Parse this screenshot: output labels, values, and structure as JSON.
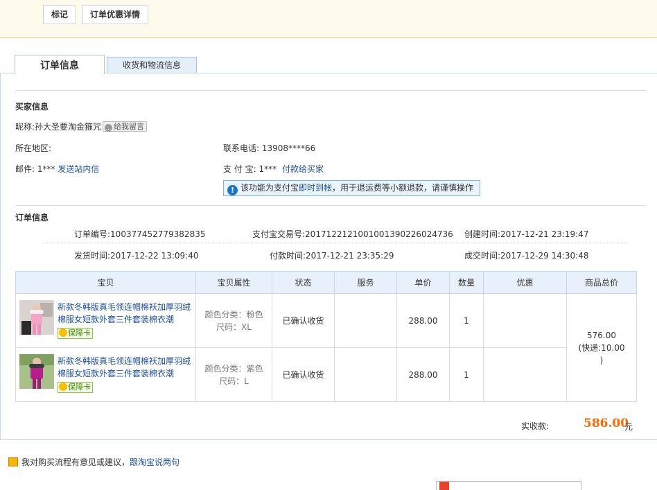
{
  "toolbar": {
    "mark_label": "标记",
    "discount_label": "订单优惠详情"
  },
  "tabs": [
    {
      "label": "订单信息"
    },
    {
      "label": "收货和物流信息"
    }
  ],
  "buyer": {
    "heading": "买家信息",
    "nickname_label": "昵称:",
    "nickname": "孙大圣要淘金箍咒",
    "message_badge": "给我留言",
    "region_label": "所在地区:",
    "phone_label": "联系电话:",
    "phone": "13908****66",
    "email_label": "邮件:",
    "email": "1***",
    "send_msg_link": "发送站内信",
    "alipay_label": "支 付 宝:",
    "alipay": "1***",
    "pay_buyer_link": "付款给买家",
    "notice_prefix": "该功能为支付宝",
    "notice_link": "即时到帐",
    "notice_suffix": "，用于退运费等小额退款，请谨慎操作"
  },
  "order": {
    "heading": "订单信息",
    "order_no_label": "订单编号:",
    "order_no": "100377452779382835",
    "alipay_tx_label": "支付宝交易号:",
    "alipay_tx": "2017122121001001390226024736",
    "created_label": "创建时间:",
    "created": "2017-12-21 23:19:47",
    "shipped_label": "发货时间:",
    "shipped": "2017-12-22 13:09:40",
    "paid_label": "付款时间:",
    "paid": "2017-12-21 23:35:29",
    "completed_label": "成交时间:",
    "completed": "2017-12-29 14:30:48"
  },
  "table": {
    "headers": [
      "宝贝",
      "宝贝属性",
      "状态",
      "服务",
      "单价",
      "数量",
      "优惠",
      "商品总价"
    ],
    "rows": [
      {
        "title": "新款冬韩版真毛领连帽棉袄加厚羽绒棉服女短款外套三件套装棉衣潮",
        "guard": "保障卡",
        "attr_color": "颜色分类：粉色",
        "attr_size": "尺码：XL",
        "status": "已确认收货",
        "service": "",
        "price": "288.00",
        "qty": "1",
        "discount": ""
      },
      {
        "title": "新款冬韩版真毛领连帽棉袄加厚羽绒棉服女短款外套三件套装棉衣潮",
        "guard": "保障卡",
        "attr_color": "颜色分类：紫色",
        "attr_size": "尺码：L",
        "status": "已确认收货",
        "service": "",
        "price": "288.00",
        "qty": "1",
        "discount": ""
      }
    ],
    "total": "576.00",
    "shipping_line": "(快递:10.00",
    "shipping_close": ")"
  },
  "summary": {
    "received_label": "实收款:",
    "received": "586.00",
    "unit": "元"
  },
  "feedback": {
    "text": "我对购买流程有意见或建议，",
    "link": "跟淘宝说两句"
  },
  "colors": {
    "accent_orange": "#ff6600",
    "link_blue": "#1e50a2",
    "tab_border": "#a9c4df"
  }
}
